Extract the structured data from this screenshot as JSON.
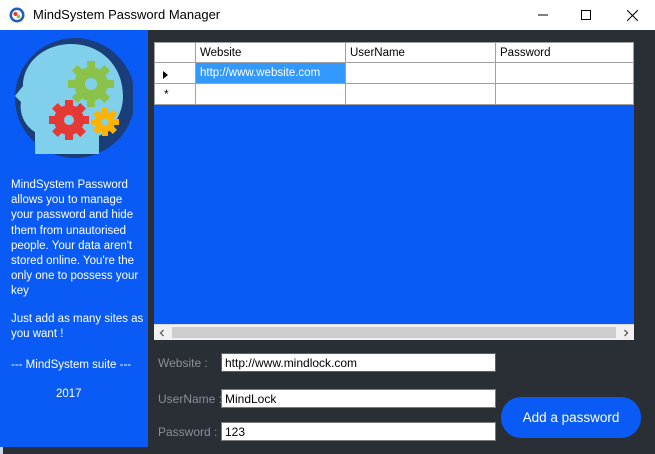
{
  "window": {
    "title": "MindSystem Password Manager",
    "icon": "mindsystem-app-icon"
  },
  "side_panel": {
    "description": "MindSystem Password allows you to manage your password and hide them from unautorised people. Your data aren't stored online. You're the only one to possess your key",
    "add_hint": "Just add as many sites as you want !",
    "suite": "--- MindSystem suite ---",
    "year": "2017"
  },
  "grid": {
    "columns": [
      "Website",
      "UserName",
      "Password"
    ],
    "rows": [
      {
        "website": "http://www.website.com",
        "username": "",
        "password": "",
        "selected_cell": "website"
      }
    ],
    "new_row_marker": "*"
  },
  "form": {
    "website_label": "Website :",
    "website_value": "http://www.mindlock.com",
    "username_label": "UserName :",
    "username_value": "MindLock",
    "password_label": "Password :",
    "password_value": "123",
    "add_button_label": "Add a password"
  },
  "colors": {
    "accent_blue": "#0a5bf6",
    "selection": "#3399ff",
    "background_dark": "#2a2e35"
  }
}
